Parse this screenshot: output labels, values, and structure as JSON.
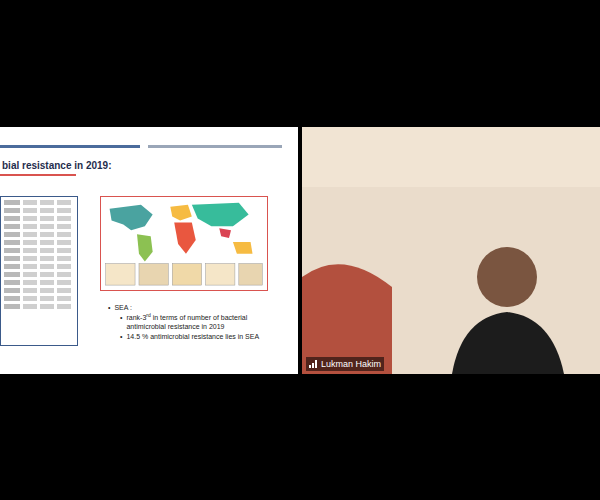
{
  "slide": {
    "title": "bial resistance in 2019:",
    "heading": "SEA :",
    "bullets": [
      {
        "before": "rank-3",
        "sup": "rd",
        "after": " in terms of number of bacterial antimicrobial resistance in 2019"
      },
      {
        "before": "14.5 % antimicrobial resistance lies in SEA",
        "sup": "",
        "after": ""
      }
    ]
  },
  "participant": {
    "name": "Lukman Hakim"
  }
}
